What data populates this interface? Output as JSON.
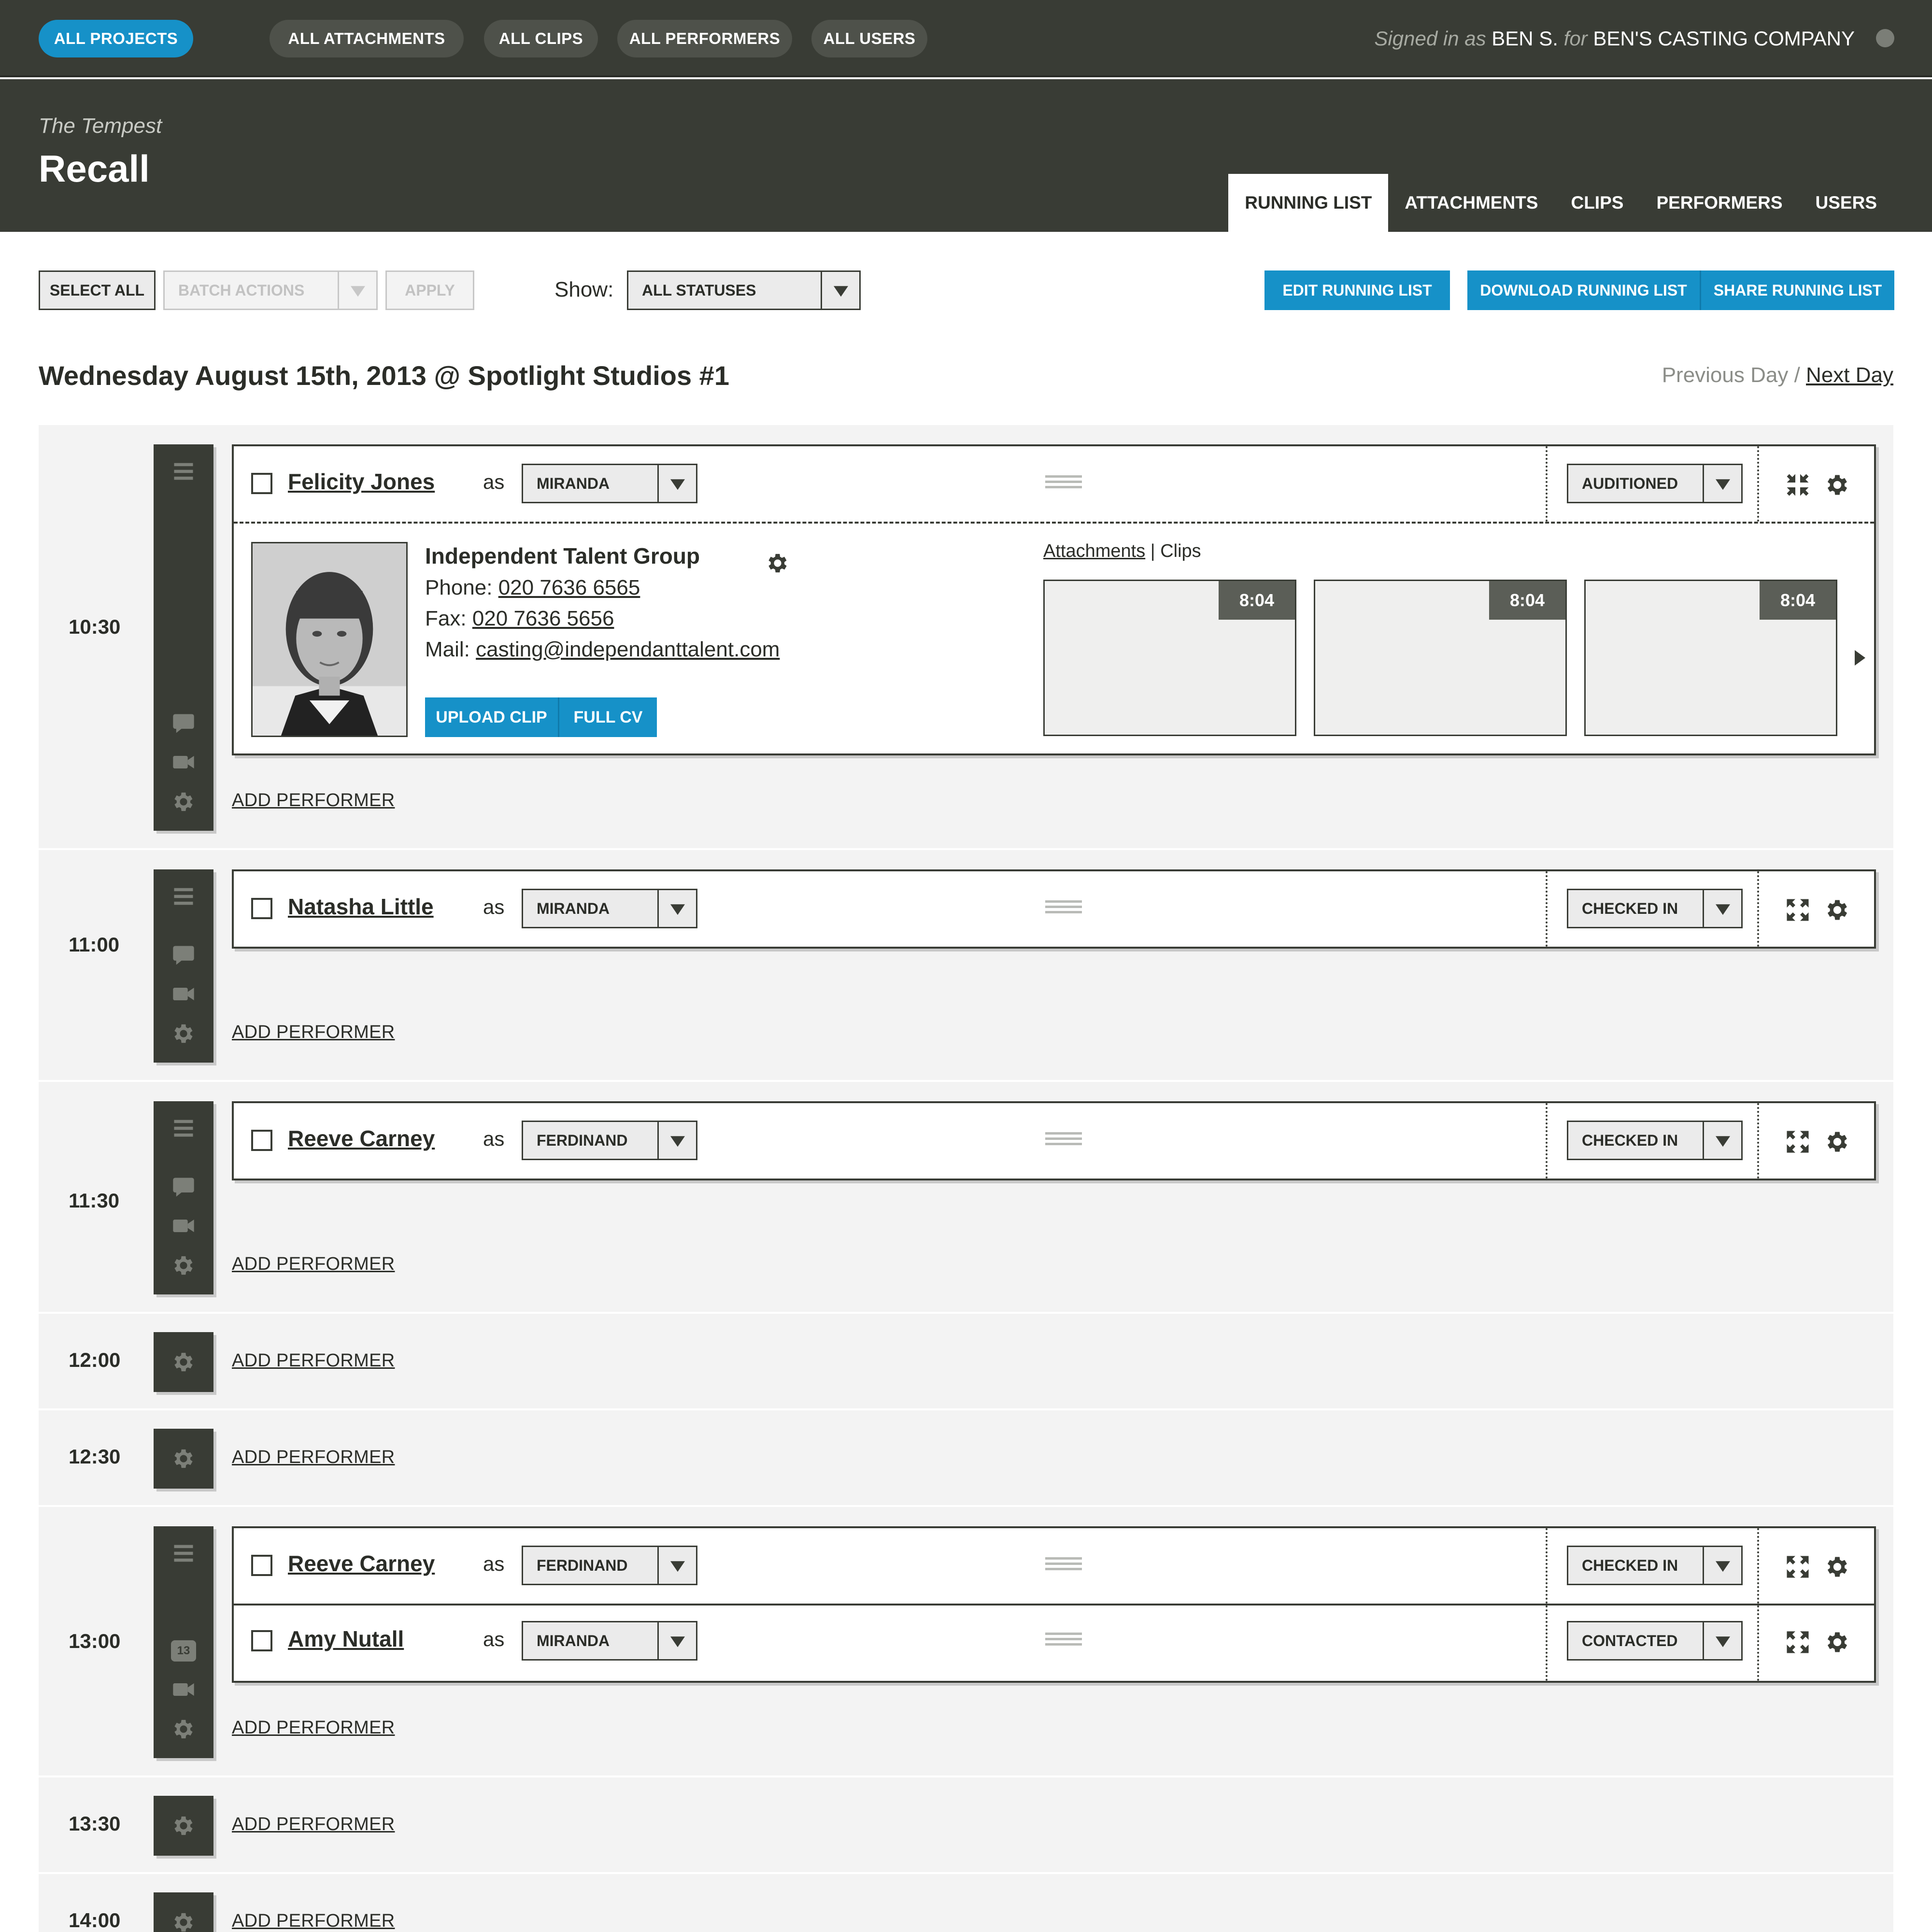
{
  "nav": {
    "pills": [
      "ALL PROJECTS",
      "ALL ATTACHMENTS",
      "ALL CLIPS",
      "ALL PERFORMERS",
      "ALL USERS"
    ],
    "signed_prefix": "Signed in as",
    "user": "BEN S.",
    "for_word": "for",
    "company": "BEN'S CASTING COMPANY"
  },
  "project": {
    "subtitle": "The Tempest",
    "title": "Recall",
    "tabs": [
      "RUNNING LIST",
      "ATTACHMENTS",
      "CLIPS",
      "PERFORMERS",
      "USERS"
    ]
  },
  "toolbar": {
    "select_all": "SELECT ALL",
    "batch_actions": "BATCH ACTIONS",
    "apply": "APPLY",
    "show_label": "Show:",
    "status_filter": "ALL STATUSES",
    "edit": "EDIT RUNNING LIST",
    "download": "DOWNLOAD RUNNING LIST",
    "share": "SHARE RUNNING LIST"
  },
  "day": {
    "heading": "Wednesday August 15th, 2013 @ Spotlight Studios #1",
    "prev": "Previous Day",
    "sep": " / ",
    "next": "Next Day"
  },
  "add_performer": "ADD PERFORMER",
  "as_word": "as",
  "slots": [
    {
      "time": "10:30"
    },
    {
      "time": "11:00"
    },
    {
      "time": "11:30"
    },
    {
      "time": "12:00"
    },
    {
      "time": "12:30"
    },
    {
      "time": "13:00",
      "comment_count": "13"
    },
    {
      "time": "13:30"
    },
    {
      "time": "14:00"
    }
  ],
  "performers": [
    {
      "name": "Felicity Jones",
      "role": "MIRANDA",
      "status": "AUDITIONED"
    },
    {
      "name": "Natasha Little",
      "role": "MIRANDA",
      "status": "CHECKED IN"
    },
    {
      "name": "Reeve Carney",
      "role": "FERDINAND",
      "status": "CHECKED IN"
    },
    {
      "name": "Reeve Carney",
      "role": "FERDINAND",
      "status": "CHECKED IN"
    },
    {
      "name": "Amy Nutall",
      "role": "MIRANDA",
      "status": "CONTACTED"
    }
  ],
  "detail": {
    "agency": "Independent Talent Group",
    "phone_label": "Phone:",
    "phone": "020 7636 6565",
    "fax_label": "Fax:",
    "fax": "020 7636 5656",
    "mail_label": "Mail:",
    "mail": "casting@independanttalent.com",
    "upload_clip": "UPLOAD CLIP",
    "full_cv": "FULL CV",
    "attachments_link": "Attachments",
    "links_sep": " | ",
    "clips_link": "Clips",
    "clip_durations": [
      "8:04",
      "8:04",
      "8:04"
    ]
  },
  "colors": {
    "dark": "#393c35",
    "accent": "#1691c8",
    "panel": "#f3f3f3"
  }
}
